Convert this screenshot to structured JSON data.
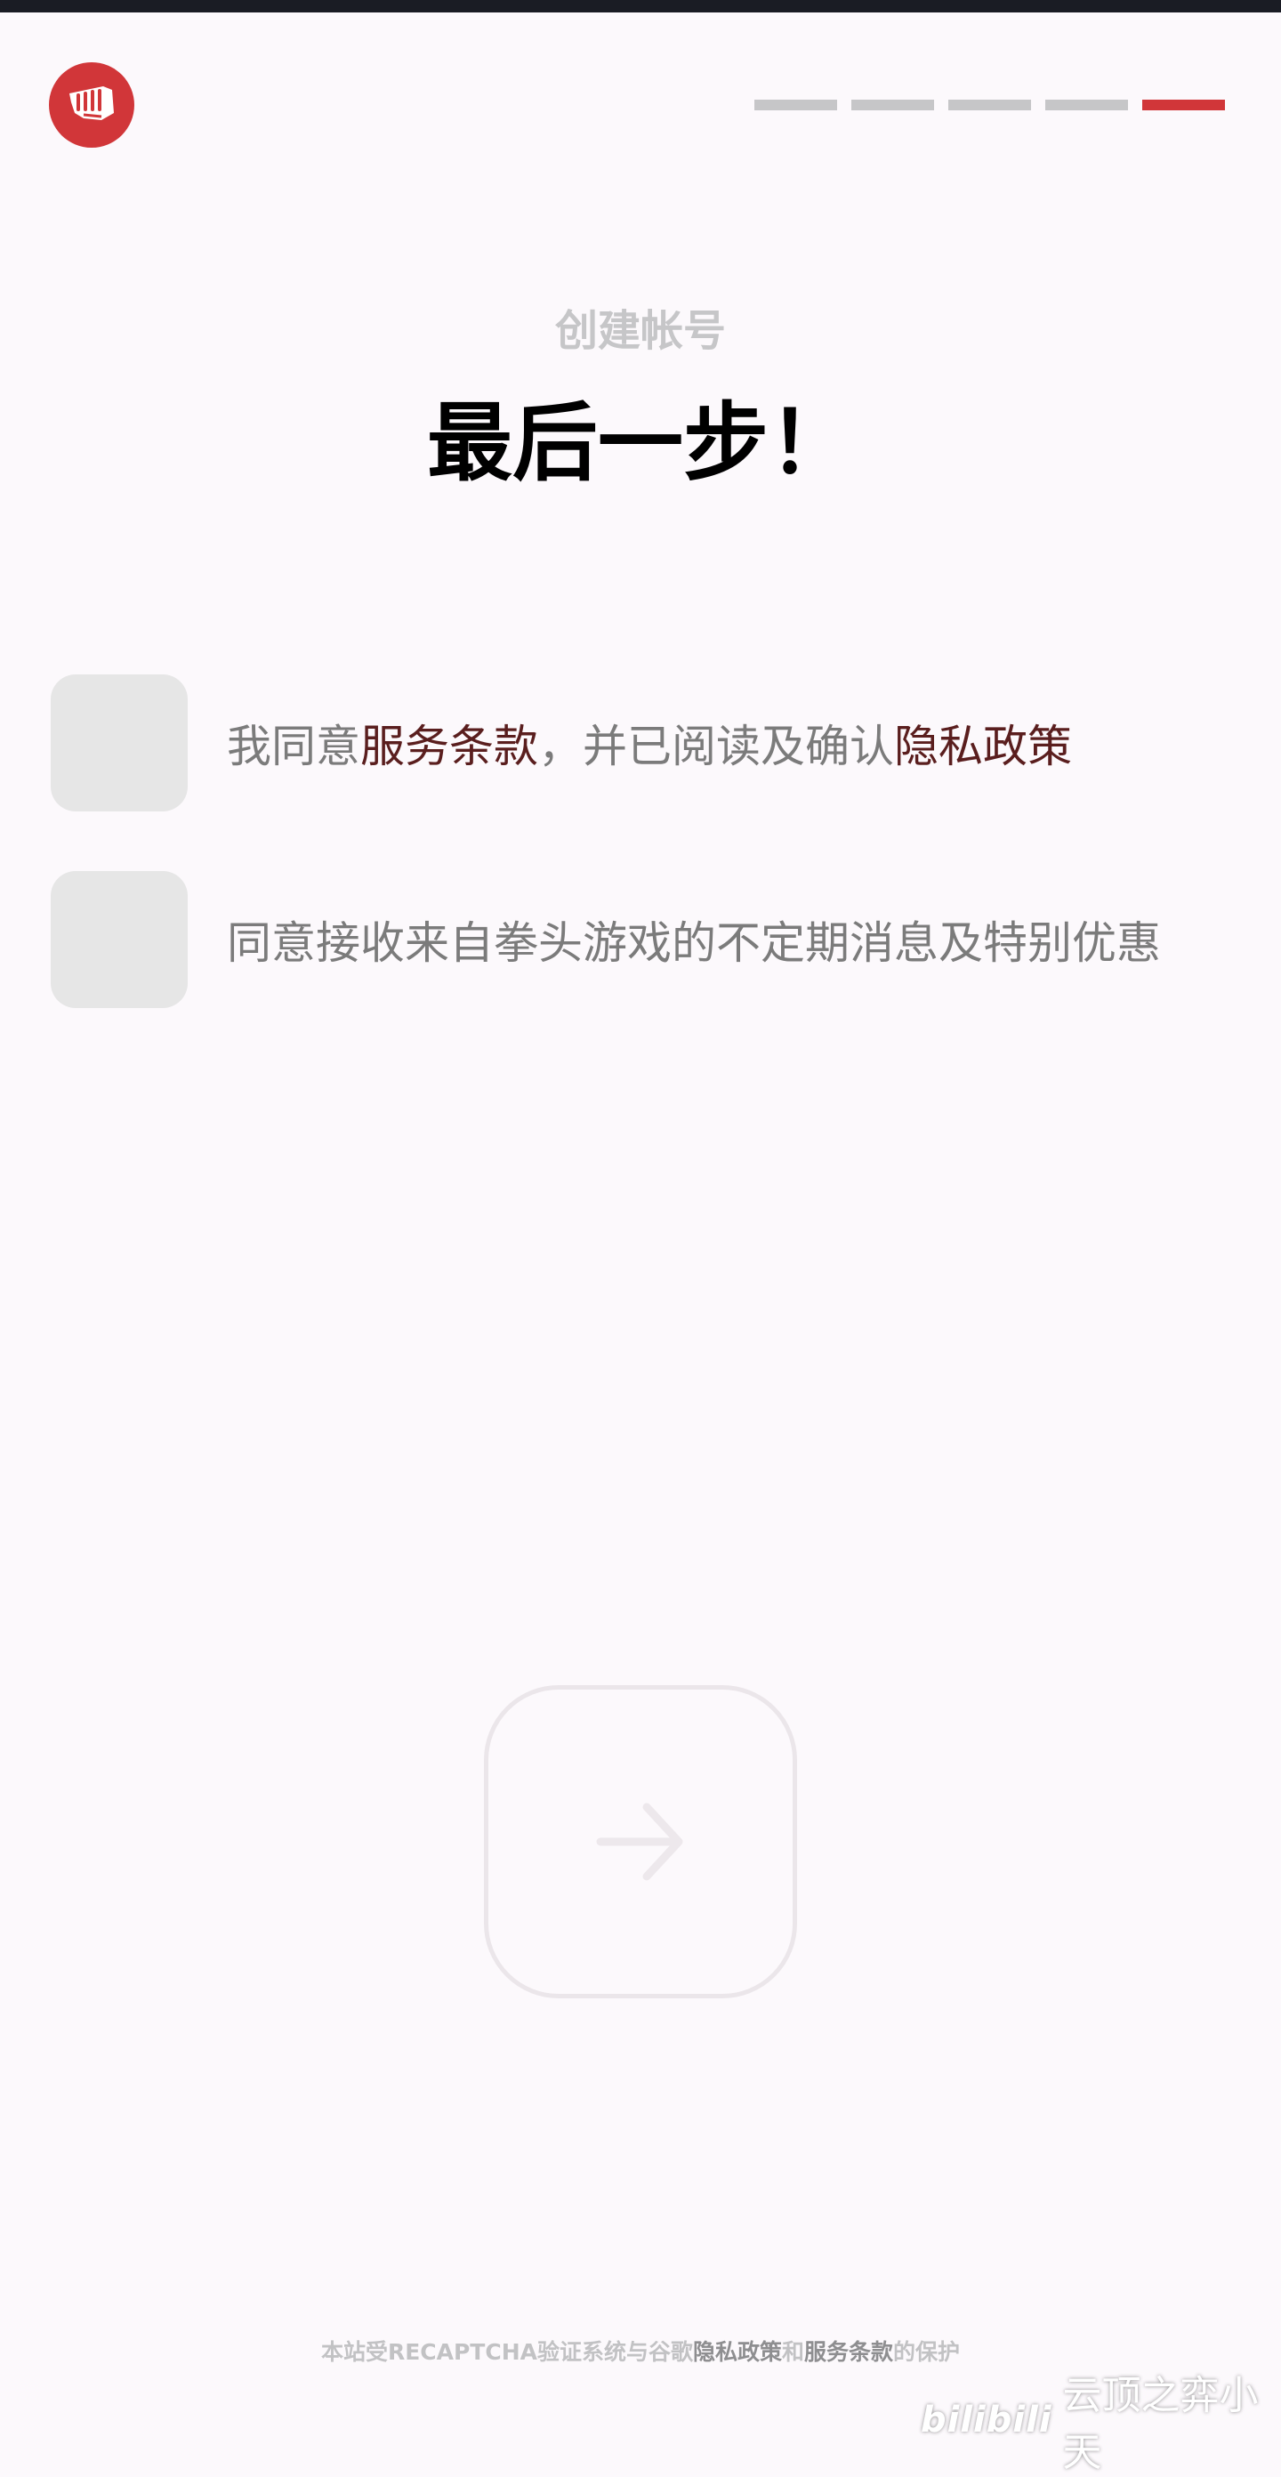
{
  "subtitle": "创建帐号",
  "title": "最后一步！",
  "progress": {
    "total_steps": 5,
    "current_step": 5
  },
  "checkboxes": [
    {
      "parts": [
        {
          "text": "我同意",
          "link": false
        },
        {
          "text": "服务条款",
          "link": true
        },
        {
          "text": "，并已阅读及确认",
          "link": false
        },
        {
          "text": "隐私政策",
          "link": true
        }
      ],
      "checked": false
    },
    {
      "parts": [
        {
          "text": "同意接收来自拳头游戏的不定期消息及特别优惠",
          "link": false
        }
      ],
      "checked": false
    }
  ],
  "next_button": {
    "icon": "arrow-right-icon",
    "enabled": false
  },
  "footer": {
    "prefix": "本站受RECAPTCHA验证系统与谷歌",
    "privacy": "隐私政策",
    "and": "和",
    "terms": "服务条款",
    "suffix": "的保护"
  },
  "watermark": {
    "brand": "bilibili",
    "text": "云顶之弈小天"
  },
  "colors": {
    "accent": "#d13639",
    "link": "#5a1e1e",
    "inactive_segment": "#c6c6c8",
    "checkbox_bg": "#e6e6e6",
    "background": "#fcf9fc"
  }
}
